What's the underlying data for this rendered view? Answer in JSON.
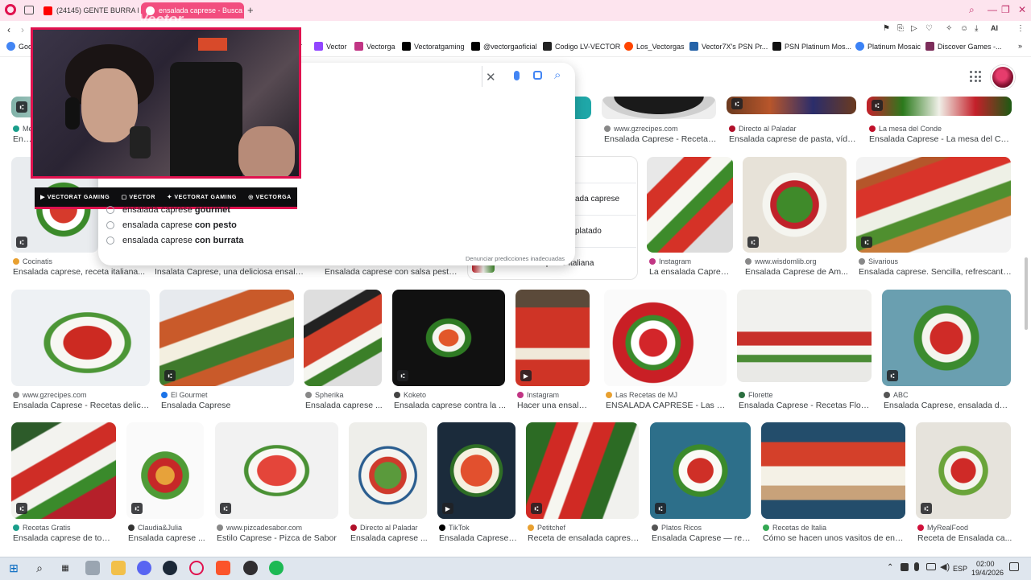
{
  "browser": {
    "tabs": [
      {
        "label": "(24145) GENTE BURRA EN",
        "active": false,
        "favicon_color": "#ff0000"
      },
      {
        "label": "ensalada caprese - Busca",
        "active": true,
        "favicon_color": "#ffffff"
      }
    ],
    "new_tab_symbol": "+",
    "accent_color": "#f24d7f",
    "ai_label": "AI"
  },
  "bookmarks": [
    {
      "label": "Goog",
      "icon": "google-icon",
      "color": "#4285f4"
    },
    {
      "label": "r",
      "icon": "folder-icon",
      "color": "#666666"
    },
    {
      "label": "Vector",
      "icon": "twitch-icon",
      "color": "#9146ff"
    },
    {
      "label": "Vectorga",
      "icon": "instagram-icon",
      "color": "#c13584"
    },
    {
      "label": "Vectoratgaming",
      "icon": "x-icon",
      "color": "#000000"
    },
    {
      "label": "@vectorgaoficial",
      "icon": "tiktok-icon",
      "color": "#000000"
    },
    {
      "label": "Codigo LV-VECTOR",
      "icon": "page-icon",
      "color": "#222222"
    },
    {
      "label": "Los_Vectorgas",
      "icon": "reddit-icon",
      "color": "#ff4500"
    },
    {
      "label": "Vector7X's PSN Pr...",
      "icon": "psn-icon",
      "color": "#2563a8"
    },
    {
      "label": "PSN Platinum Mos...",
      "icon": "page-icon",
      "color": "#111111"
    },
    {
      "label": "Platinum Mosaic",
      "icon": "mosaic-icon",
      "color": "#3b82f6"
    },
    {
      "label": "Discover Games -...",
      "icon": "games-icon",
      "color": "#7c2d5a"
    }
  ],
  "search": {
    "suggestions": [
      {
        "prefix": "ensalada caprese ",
        "bold": "gourmet"
      },
      {
        "prefix": "ensalada caprese ",
        "bold": "con pesto"
      },
      {
        "prefix": "ensalada caprese ",
        "bold": "con burrata"
      }
    ],
    "report_link": "Denunciar predicciones inadecuadas"
  },
  "related": [
    {
      "label": "ada caprese"
    },
    {
      "label": "platado"
    },
    {
      "label": "ensalada caprese italiana"
    }
  ],
  "stream_overlay": {
    "social": [
      "VECTORAT GAMING",
      "VECTOR",
      "VECTORAT GAMING",
      "VECTORGA"
    ],
    "watermark": "Vector"
  },
  "top_row": [
    {
      "source": "Me",
      "title": "Ensalada",
      "color": "#1a9e8b"
    },
    {
      "source": "www.gzrecipes.com",
      "title": "Ensalada Caprese - Recetas ...",
      "color": "#888888"
    },
    {
      "source": "Directo al Paladar",
      "title": "Ensalada caprese de pasta, víde...",
      "color": "#b0102a"
    },
    {
      "source": "La mesa del Conde",
      "title": "Ensalada Caprese - La mesa del Conde",
      "color": "#c0102a"
    }
  ],
  "row2": [
    {
      "source": "Cocinatis",
      "title": "Ensalada caprese, receta italiana...",
      "color": "#e8a030"
    },
    {
      "source": "",
      "title": "Insalata Caprese, una deliciosa ensalada ...",
      "color": "#888888"
    },
    {
      "source": "",
      "title": "Ensalada caprese con salsa pesto -...",
      "color": "#34a853"
    },
    {
      "source": "Instagram",
      "title": "La ensalada Caprese...",
      "color": "#c13584"
    },
    {
      "source": "www.wisdomlib.org",
      "title": "Ensalada Caprese de Am...",
      "color": "#888888"
    },
    {
      "source": "Sivarious",
      "title": "Ensalada caprese. Sencilla, refrescante y ...",
      "color": "#888888"
    }
  ],
  "row3": [
    {
      "source": "www.gzrecipes.com",
      "title": "Ensalada Caprese - Recetas delicio...",
      "color": "#888888"
    },
    {
      "source": "El Gourmet",
      "title": "Ensalada Caprese",
      "color": "#1a73e8"
    },
    {
      "source": "Spherika",
      "title": "Ensalada caprese ...",
      "color": "#888888"
    },
    {
      "source": "Koketo",
      "title": "Ensalada caprese contra la ...",
      "color": "#444444"
    },
    {
      "source": "Instagram",
      "title": "Hacer una ensalad...",
      "color": "#c13584"
    },
    {
      "source": "Las Recetas de MJ",
      "title": "ENSALADA CAPRESE - Las Re...",
      "color": "#e8a030"
    },
    {
      "source": "Florette",
      "title": "Ensalada Caprese - Recetas Florette",
      "color": "#2b6e3f"
    },
    {
      "source": "ABC",
      "title": "Ensalada Caprese, ensalada de t...",
      "color": "#555555"
    }
  ],
  "row4": [
    {
      "source": "Recetas Gratis",
      "title": "Ensalada caprese de toma...",
      "color": "#1a9e8b"
    },
    {
      "source": "Claudia&Julia",
      "title": "Ensalada caprese ...",
      "color": "#333333"
    },
    {
      "source": "www.pizcadesabor.com",
      "title": "Estilo Caprese - Pizca de Sabor",
      "color": "#888888"
    },
    {
      "source": "Directo al Paladar",
      "title": "Ensalada caprese ...",
      "color": "#b0102a"
    },
    {
      "source": "TikTok",
      "title": "Ensalada Caprese:...",
      "color": "#000000"
    },
    {
      "source": "Petitchef",
      "title": "Receta de ensalada caprese ...",
      "color": "#e8a030"
    },
    {
      "source": "Platos Ricos",
      "title": "Ensalada Caprese — rec...",
      "color": "#555555"
    },
    {
      "source": "Recetas de Italia",
      "title": "Cómo se hacen unos vasitos de ensal...",
      "color": "#34a853"
    },
    {
      "source": "MyRealFood",
      "title": "Receta de Ensalada ca...",
      "color": "#d0103a"
    }
  ],
  "taskbar": {
    "lang": "ESP",
    "time": "02:00",
    "date": "19/4/2026"
  }
}
